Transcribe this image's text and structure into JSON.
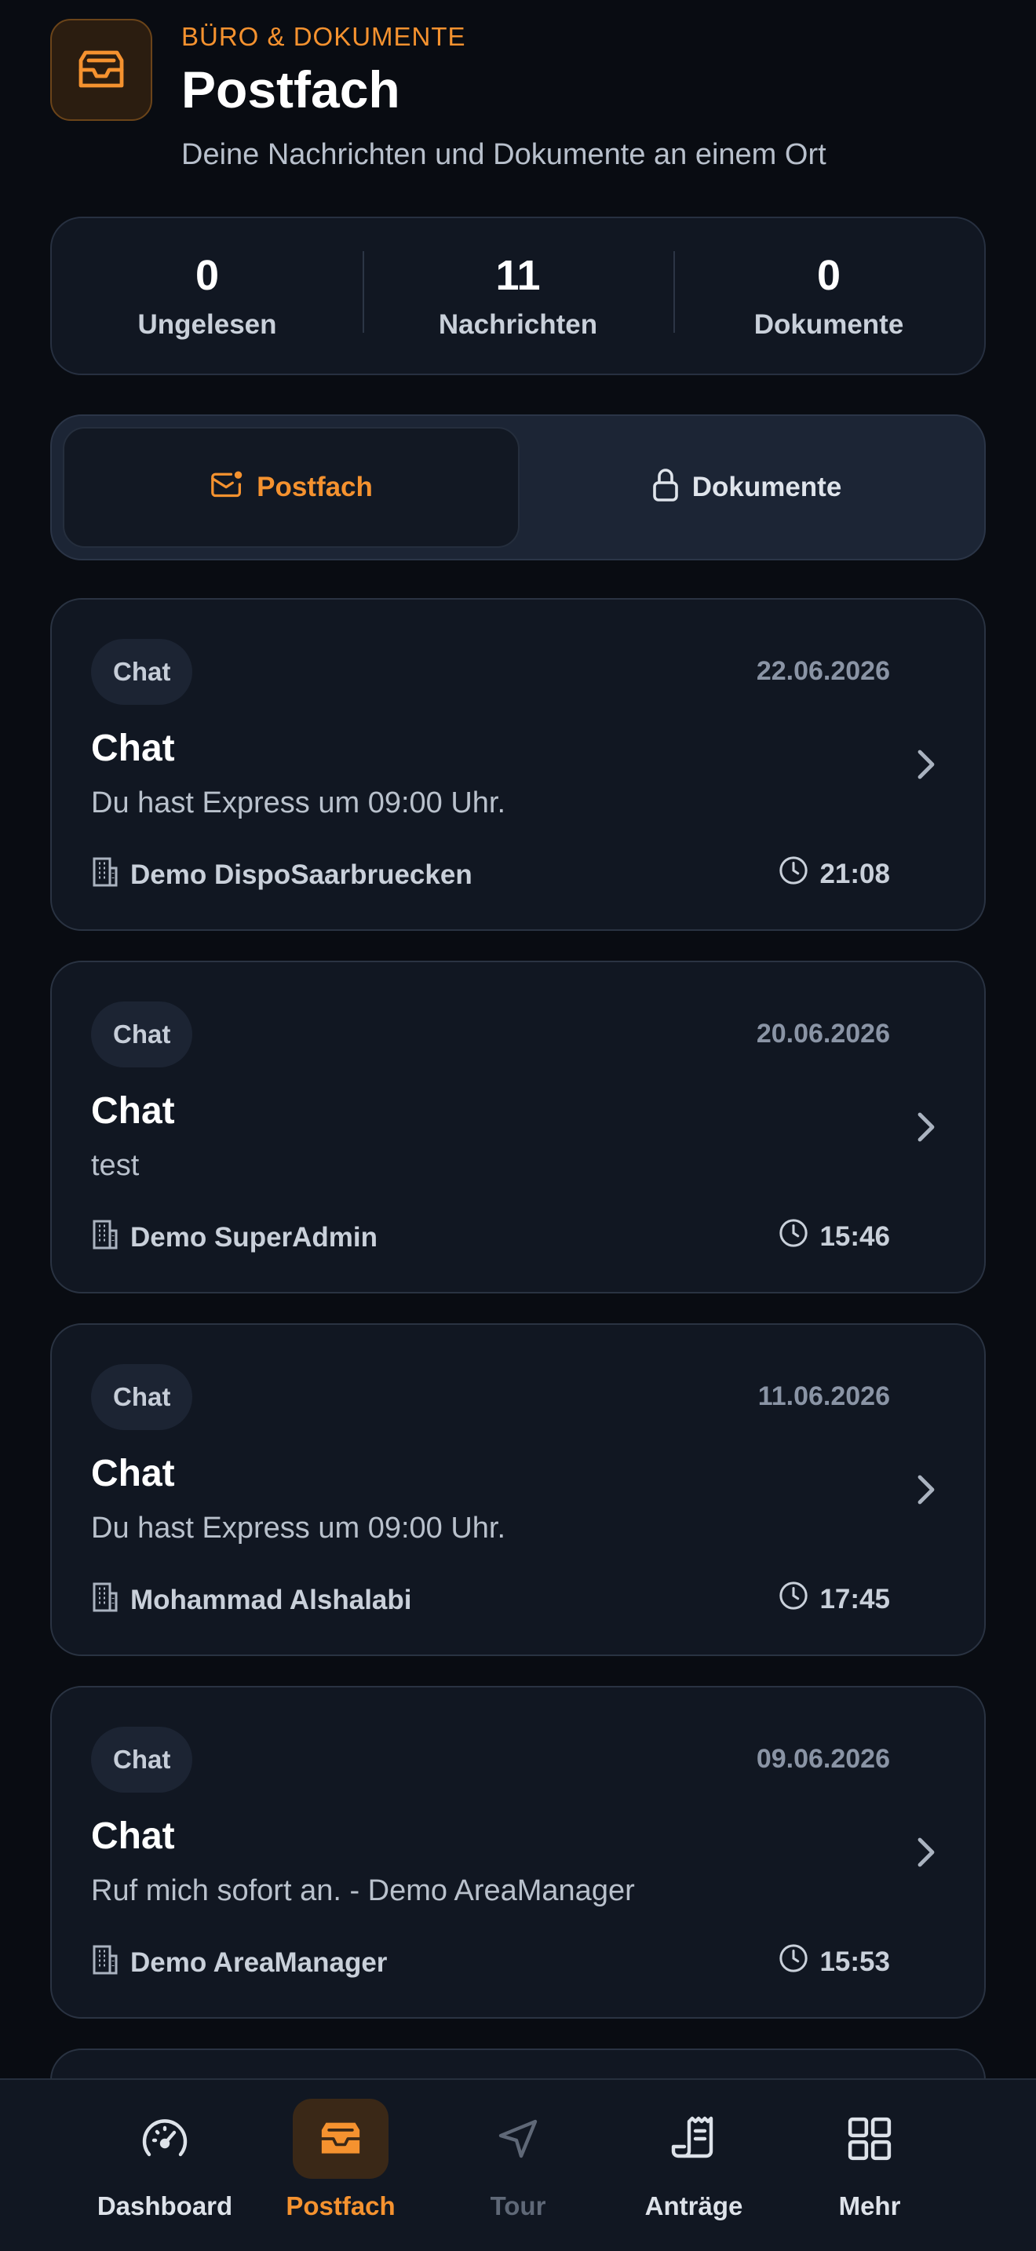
{
  "header": {
    "eyebrow": "BÜRO & DOKUMENTE",
    "title": "Postfach",
    "subtitle": "Deine Nachrichten und Dokumente an einem Ort"
  },
  "stats": [
    {
      "value": "0",
      "label": "Ungelesen"
    },
    {
      "value": "11",
      "label": "Nachrichten"
    },
    {
      "value": "0",
      "label": "Dokumente"
    }
  ],
  "tabs": [
    {
      "label": "Postfach",
      "icon": "mail-notification-icon",
      "active": true
    },
    {
      "label": "Dokumente",
      "icon": "lock-icon",
      "active": false
    }
  ],
  "messages": [
    {
      "tag": "Chat",
      "date": "22.06.2026",
      "title": "Chat",
      "text": "Du hast Express um 09:00 Uhr.",
      "sender": "Demo DispoSaarbruecken",
      "time": "21:08"
    },
    {
      "tag": "Chat",
      "date": "20.06.2026",
      "title": "Chat",
      "text": "test",
      "sender": "Demo SuperAdmin",
      "time": "15:46"
    },
    {
      "tag": "Chat",
      "date": "11.06.2026",
      "title": "Chat",
      "text": "Du hast Express um 09:00 Uhr.",
      "sender": "Mohammad Alshalabi",
      "time": "17:45"
    },
    {
      "tag": "Chat",
      "date": "09.06.2026",
      "title": "Chat",
      "text": "Ruf mich sofort an. - Demo AreaManager",
      "sender": "Demo AreaManager",
      "time": "15:53"
    }
  ],
  "nav": [
    {
      "label": "Dashboard",
      "icon": "speedometer-icon"
    },
    {
      "label": "Postfach",
      "icon": "inbox-icon",
      "active": true
    },
    {
      "label": "Tour",
      "icon": "navigation-arrow-icon",
      "disabled": true
    },
    {
      "label": "Anträge",
      "icon": "document-scroll-icon"
    },
    {
      "label": "Mehr",
      "icon": "grid-icon"
    }
  ],
  "colors": {
    "accent": "#f5922f",
    "background": "#090c12",
    "card": "#111722"
  }
}
